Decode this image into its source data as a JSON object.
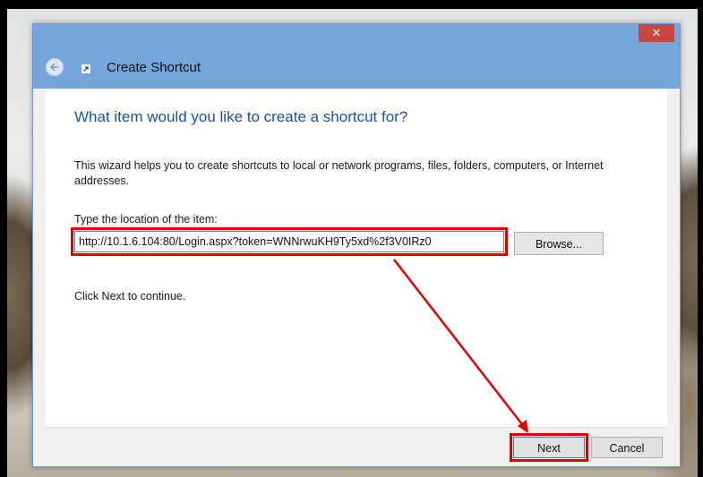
{
  "window": {
    "title": "Create Shortcut",
    "close_glyph": "✕"
  },
  "wizard": {
    "heading": "What item would you like to create a shortcut for?",
    "description": "This wizard helps you to create shortcuts to local or network programs, files, folders, computers, or Internet addresses.",
    "location_label": "Type the location of the item:",
    "location_value": "http://10.1.6.104:80/Login.aspx?token=WNNrwuKH9Ty5xd%2f3V0IRz0",
    "browse_label": "Browse...",
    "continue_text": "Click Next to continue."
  },
  "footer": {
    "next_label": "Next",
    "cancel_label": "Cancel"
  },
  "icons": {
    "back": "back-arrow-icon",
    "shortcut": "shortcut-icon",
    "close": "close-icon"
  },
  "colors": {
    "titlebar": "#74a6dc",
    "close_button": "#c7483e",
    "heading_text": "#1a4fb0",
    "annotation_red": "#e00000"
  }
}
